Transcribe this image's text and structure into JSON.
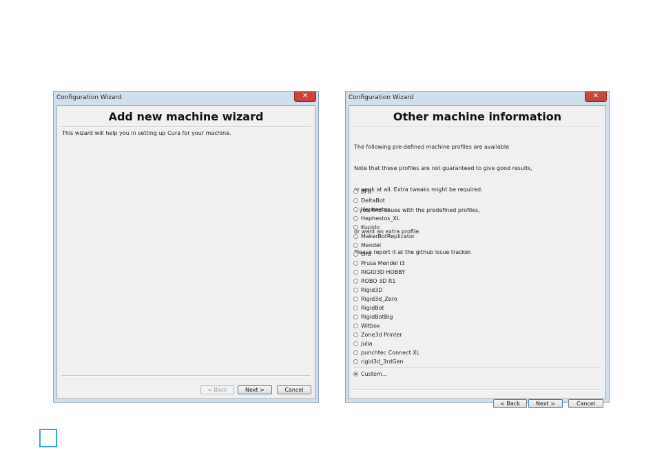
{
  "left_window": {
    "title": "Configuration Wizard",
    "close_glyph": "✕",
    "heading": "Add new machine wizard",
    "description": "This wizard will help you in setting up Cura for your machine.",
    "buttons": {
      "back": "< Back",
      "next": "Next >",
      "cancel": "Cancel"
    }
  },
  "right_window": {
    "title": "Configuration Wizard",
    "close_glyph": "✕",
    "heading": "Other machine information",
    "info_lines": [
      "The following pre-defined machine profiles are available",
      "Note that these profiles are not guaranteed to give good results,",
      "or work at all. Extra tweaks might be required.",
      "If you find issues with the predefined profiles,",
      "or want an extra profile.",
      "Please report it at the github issue tracker."
    ],
    "profiles": [
      "BFB",
      "DeltaBot",
      "Hephestos",
      "Hephestos_XL",
      "Kupido",
      "MakerBotReplicator",
      "Mendel",
      "Ord",
      "Prusa Mendel i3",
      "RIGID3D HOBBY",
      "ROBO 3D R1",
      "Rigid3D",
      "Rigid3d_Zero",
      "RigidBot",
      "RigidBotBig",
      "Witbox",
      "Zone3d Printer",
      "julia",
      "punchtec Connect XL",
      "rigid3d_3rdGen"
    ],
    "custom_label": "Custom...",
    "selected": "Custom...",
    "buttons": {
      "back": "< Back",
      "next": "Next >",
      "cancel": "Cancel"
    }
  },
  "colors": {
    "accent_marker": "#2fa6d9",
    "close_button": "#c9463d",
    "frame": "#cfdfee"
  }
}
